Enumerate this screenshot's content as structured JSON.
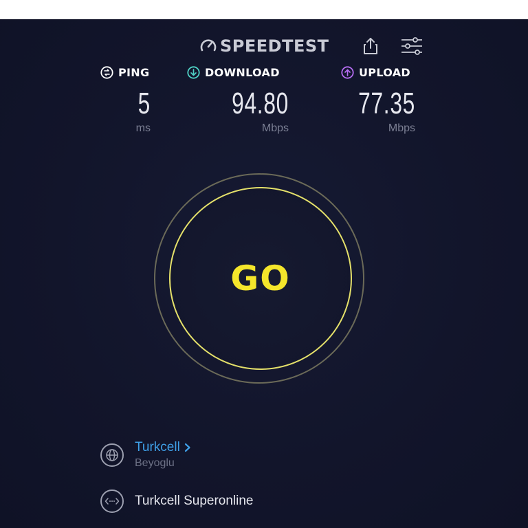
{
  "header": {
    "logo_text": "SPEEDTEST",
    "logo_icon": "speedometer-icon",
    "share_icon": "share-icon",
    "settings_icon": "settings-sliders-icon"
  },
  "metrics": {
    "ping": {
      "label": "PING",
      "value": "5",
      "unit": "ms",
      "icon": "ping-icon",
      "color": "#ffffff"
    },
    "download": {
      "label": "DOWNLOAD",
      "value": "94.80",
      "unit": "Mbps",
      "icon": "download-arrow-icon",
      "color": "#4fd1c5"
    },
    "upload": {
      "label": "UPLOAD",
      "value": "77.35",
      "unit": "Mbps",
      "icon": "upload-arrow-icon",
      "color": "#b46cf0"
    }
  },
  "go_button": {
    "label": "GO",
    "color": "#f5e62b"
  },
  "provider": {
    "isp_name": "Turkcell",
    "isp_location": "Beyoglu",
    "server_name": "Turkcell Superonline",
    "isp_icon": "globe-icon",
    "server_icon": "server-icon",
    "link_color": "#3fa0e8"
  },
  "colors": {
    "background": "#12152b",
    "go_ring": "#e4e06a"
  }
}
